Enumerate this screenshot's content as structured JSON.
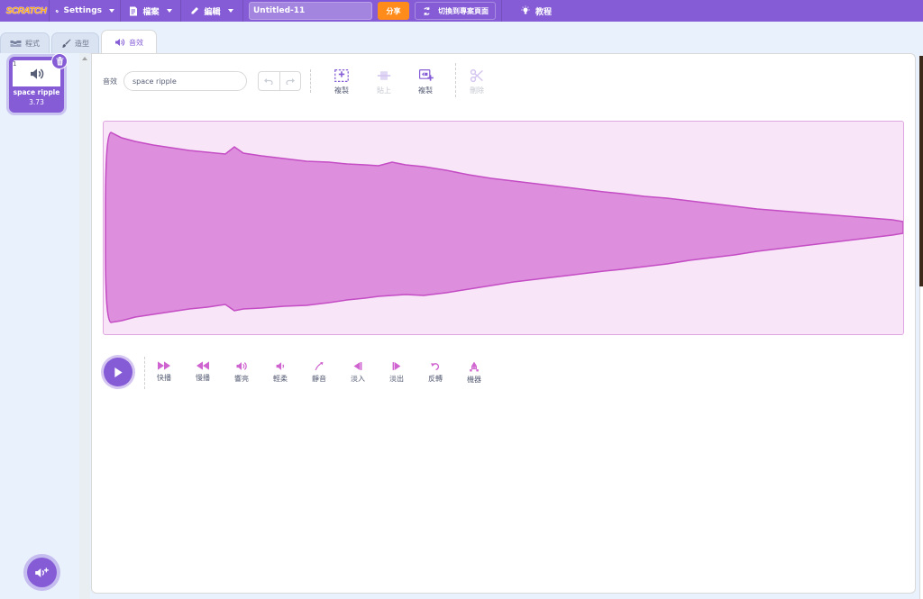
{
  "menubar": {
    "logo_text": "SCRATCH",
    "settings_label": "Settings",
    "file_label": "檔案",
    "edit_label": "編輯",
    "project_title": "Untitled-11",
    "share_label": "分享",
    "see_project_page_label": "切換到專案頁面",
    "tutorials_label": "教程"
  },
  "tabs": [
    {
      "label": "程式",
      "icon": "code-icon",
      "active": false
    },
    {
      "label": "造型",
      "icon": "paintbrush-icon",
      "active": false
    },
    {
      "label": "音效",
      "icon": "speaker-icon",
      "active": true
    }
  ],
  "sound_list": [
    {
      "index": "1",
      "name": "space ripple",
      "duration": "3.73",
      "selected": true
    }
  ],
  "editor": {
    "sound_label": "音效",
    "sound_name": "space ripple",
    "tools": [
      {
        "label": "複製",
        "icon": "copy-icon",
        "enabled": true
      },
      {
        "label": "貼上",
        "icon": "paste-icon",
        "enabled": false
      },
      {
        "label": "複製",
        "icon": "copy-to-new-icon",
        "enabled": true
      },
      {
        "label": "刪除",
        "icon": "scissors-icon",
        "enabled": false
      }
    ],
    "effects": [
      {
        "label": "快播",
        "icon": "faster-icon"
      },
      {
        "label": "慢播",
        "icon": "slower-icon"
      },
      {
        "label": "響亮",
        "icon": "louder-icon"
      },
      {
        "label": "輕柔",
        "icon": "softer-icon"
      },
      {
        "label": "靜音",
        "icon": "mute-icon"
      },
      {
        "label": "淡入",
        "icon": "fade-in-icon"
      },
      {
        "label": "淡出",
        "icon": "fade-out-icon"
      },
      {
        "label": "反轉",
        "icon": "reverse-icon"
      },
      {
        "label": "機器",
        "icon": "robot-icon"
      }
    ]
  },
  "colors": {
    "brand": "#855cd6",
    "share": "#ff8c1a",
    "waveform_fill": "#dd8fdd",
    "waveform_stroke": "#c44cc4",
    "waveform_bg": "#f8e6f8",
    "effect_icon": "#cf63cf"
  }
}
